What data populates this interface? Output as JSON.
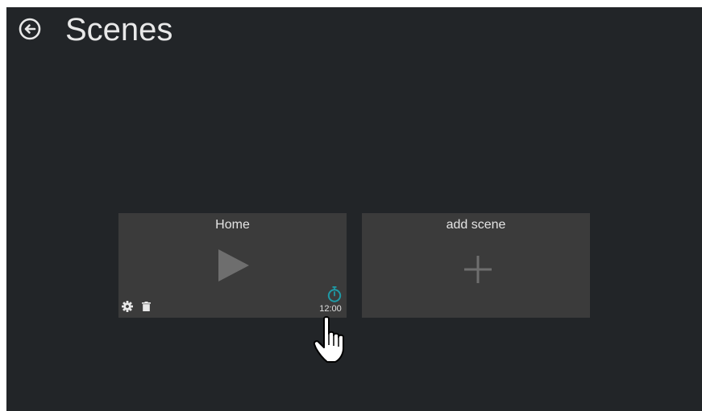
{
  "header": {
    "title": "Scenes",
    "back_icon": "back-arrow-circle-icon"
  },
  "scenes": [
    {
      "label": "Home",
      "action_icon": "play-icon",
      "settings_icon": "gear-icon",
      "delete_icon": "trash-icon",
      "timer_icon": "stopwatch-icon",
      "timer_time": "12:00"
    }
  ],
  "add_tile": {
    "label": "add scene",
    "icon": "plus-icon"
  },
  "colors": {
    "background": "#222528",
    "tile": "#3b3b3b",
    "timer_accent": "#1e9aa6",
    "icon_muted": "#6e6e6e"
  }
}
